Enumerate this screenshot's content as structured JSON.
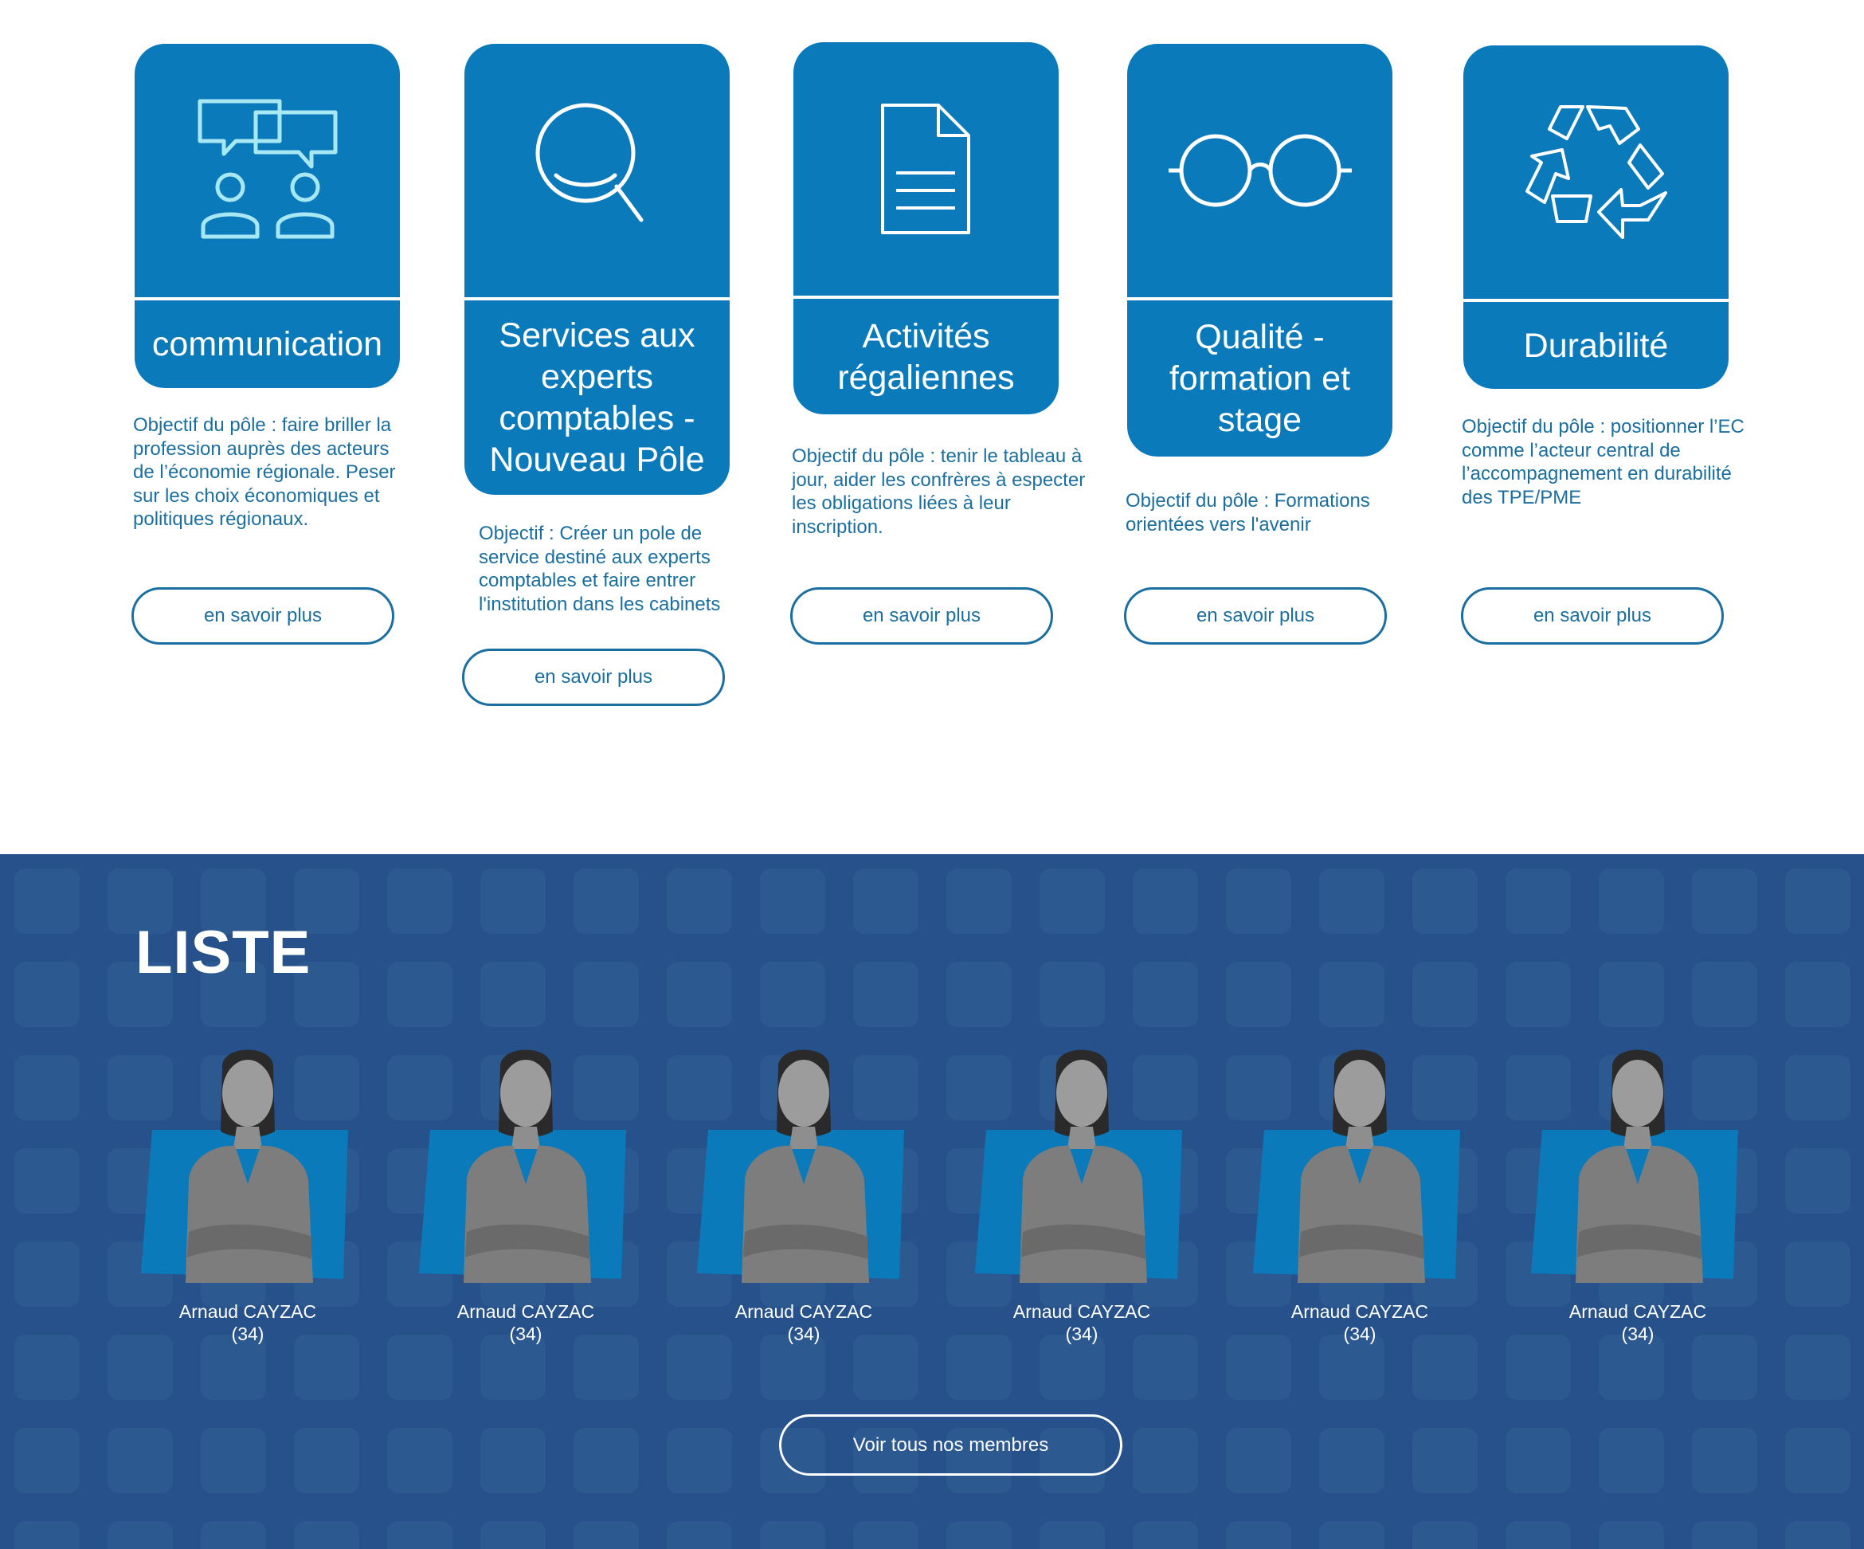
{
  "poles": [
    {
      "title": "communication",
      "icon": "speech-bubbles-people-icon",
      "description": "Objectif du pôle : faire briller la profession auprès des acteurs de l’économie régionale. Peser sur les choix économiques et politiques régionaux.",
      "button": "en savoir plus"
    },
    {
      "title": "Services aux experts comptables - Nouveau Pôle",
      "icon": "magnifier-icon",
      "description": "Objectif : Créer un pole de service destiné aux experts comptables et faire entrer l'institution dans les cabinets",
      "button": "en savoir plus"
    },
    {
      "title": "Activités régaliennes",
      "icon": "document-icon",
      "description": "Objectif du pôle : tenir le tableau à jour, aider les confrères à especter les obligations liées à leur inscription.",
      "button": "en savoir plus"
    },
    {
      "title": "Qualité - formation et stage",
      "icon": "glasses-icon",
      "description": "Objectif du pôle : Formations orientées vers l'avenir",
      "button": "en savoir plus"
    },
    {
      "title": "Durabilité",
      "icon": "recycle-icon",
      "description": "Objectif du pôle : positionner l’EC comme l’acteur central de l’accompagnement en durabilité des TPE/PME",
      "button": "en savoir plus"
    }
  ],
  "liste": {
    "title": "LISTE",
    "members": [
      {
        "name": "Arnaud CAYZAC",
        "dept": "(34)"
      },
      {
        "name": "Arnaud CAYZAC",
        "dept": "(34)"
      },
      {
        "name": "Arnaud CAYZAC",
        "dept": "(34)"
      },
      {
        "name": "Arnaud CAYZAC",
        "dept": "(34)"
      },
      {
        "name": "Arnaud CAYZAC",
        "dept": "(34)"
      },
      {
        "name": "Arnaud CAYZAC",
        "dept": "(34)"
      }
    ],
    "all_button": "Voir tous nos membres"
  },
  "colors": {
    "card_blue": "#0a7abb",
    "text_blue": "#1a6fa0",
    "section_navy": "#26518a"
  }
}
